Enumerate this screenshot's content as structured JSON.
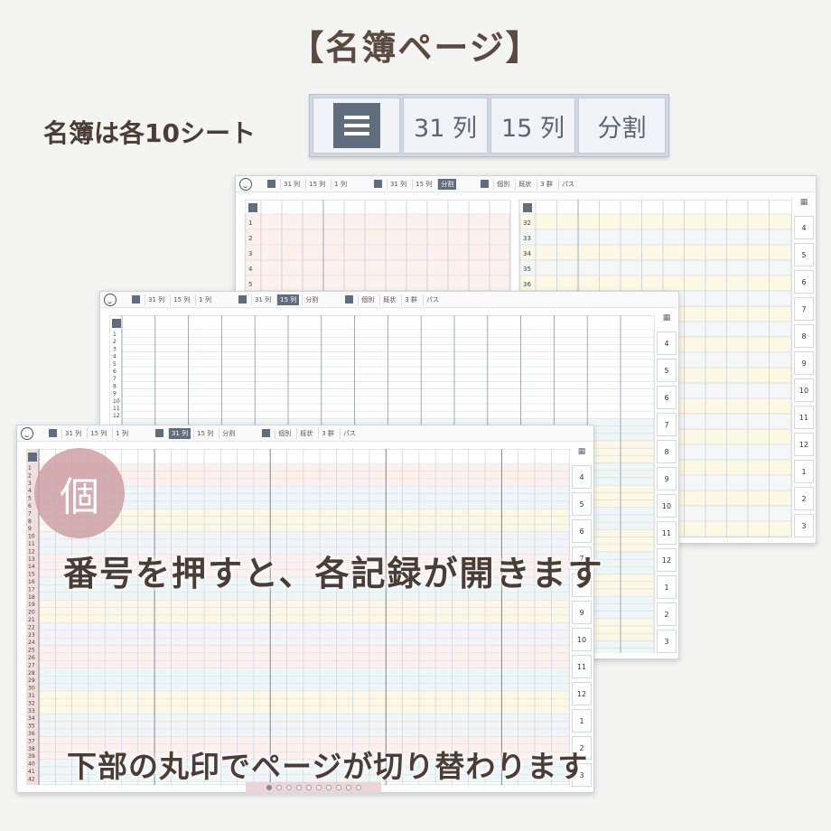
{
  "headline": "【名簿ページ】",
  "subhead": "名簿は各10シート",
  "view_tabs": {
    "list_icon": "list-icon",
    "col31": "31 列",
    "col15": "15 列",
    "split": "分割"
  },
  "sheet_toolbar": {
    "face_icon": "face-icon",
    "g1": [
      "31 列",
      "15 列",
      "1 列"
    ],
    "g2": [
      "31 列",
      "15 列",
      "分割"
    ],
    "g3": [
      "個別",
      "既状",
      "3 群",
      "パス"
    ]
  },
  "back_sheet": {
    "left_rows": [
      "1",
      "2",
      "3",
      "4",
      "5"
    ],
    "right_rows": [
      "32",
      "33",
      "34",
      "35",
      "36"
    ],
    "rail": [
      "4",
      "5",
      "6",
      "7",
      "8",
      "9",
      "10",
      "11",
      "12",
      "1",
      "2",
      "3"
    ]
  },
  "mid_sheet": {
    "rows": [
      "1",
      "2",
      "3",
      "4",
      "5",
      "6",
      "7",
      "8",
      "9",
      "10",
      "11",
      "12"
    ],
    "rail": [
      "4",
      "5",
      "6",
      "7",
      "8",
      "9",
      "10",
      "11",
      "12",
      "1",
      "2",
      "3"
    ]
  },
  "front_sheet": {
    "rows": [
      "1",
      "2",
      "3",
      "4",
      "5",
      "6",
      "7",
      "8",
      "9",
      "10",
      "11",
      "12",
      "13",
      "14",
      "15",
      "16",
      "17",
      "18",
      "19",
      "20",
      "21",
      "22",
      "23",
      "24",
      "25",
      "26",
      "27",
      "28",
      "29",
      "30",
      "31",
      "32",
      "33",
      "34",
      "35",
      "36",
      "37",
      "38",
      "39",
      "40",
      "41",
      "42"
    ],
    "rail": [
      "4",
      "5",
      "6",
      "7",
      "8",
      "9",
      "10",
      "11",
      "12",
      "1",
      "2",
      "3"
    ]
  },
  "badge": "個",
  "caption_number": "番号を押すと、各記録が開きます",
  "caption_pager": "下部の丸印でページが切り替わります",
  "pager": {
    "pages": 10,
    "active_page": 1
  },
  "colors": {
    "accent": "#5f6d7d",
    "badge": "#cda0a5",
    "text": "#4a3c36"
  }
}
